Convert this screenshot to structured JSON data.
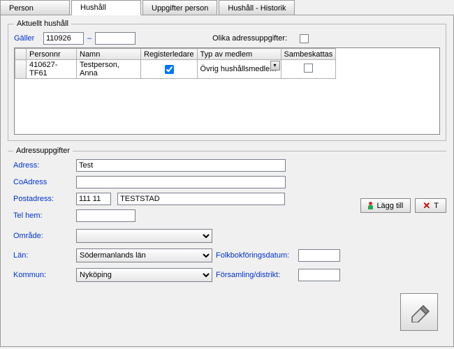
{
  "tabs": {
    "person": "Person",
    "hushall": "Hushåll",
    "uppgifter": "Uppgifter person",
    "historik": "Hushåll - Historik"
  },
  "fieldset1": {
    "legend": "Aktuellt hushåll",
    "galler_label": "Gäller",
    "galler_value": "110926",
    "olika_label": "Olika adressuppgifter:"
  },
  "grid": {
    "headers": {
      "personnr": "Personnr",
      "namn": "Namn",
      "registerledare": "Registerledare",
      "typ": "Typ av medlem",
      "sambeskattas": "Sambeskattas"
    },
    "row": {
      "personnr": "410627-TF61",
      "namn": "Testperson, Anna",
      "typ": "Övrig hushållsmedlem"
    }
  },
  "fieldset2": {
    "legend": "Adressuppgifter",
    "adress_label": "Adress:",
    "adress_value": "Test",
    "coadress_label": "CoAdress",
    "postadress_label": "Postadress:",
    "postnr_value": "111 11",
    "postort_value": "TESTSTAD",
    "telhem_label": "Tel hem:",
    "omrade_label": "Område:",
    "lan_label": "Län:",
    "lan_value": "Södermanlands län",
    "kommun_label": "Kommun:",
    "kommun_value": "Nyköping",
    "folkbok_label": "Folkbokföringsdatum:",
    "forsamling_label": "Församling/distrikt:"
  },
  "buttons": {
    "lagg_till": "Lägg till",
    "ta_bort_partial": "T"
  }
}
